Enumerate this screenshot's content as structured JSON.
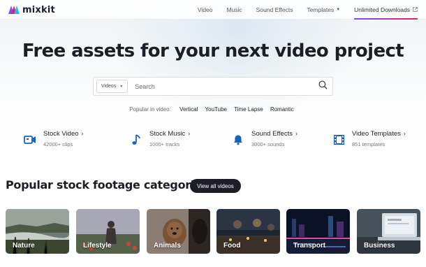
{
  "brand": {
    "name": "mixkit",
    "icon": "mixkit-logo"
  },
  "nav": [
    {
      "label": "Video"
    },
    {
      "label": "Music"
    },
    {
      "label": "Sound Effects"
    },
    {
      "label": "Templates",
      "has_dropdown": true
    },
    {
      "label": "Unlimited Downloads",
      "icon": "external-link-icon",
      "active": true
    }
  ],
  "hero": {
    "title": "Free assets for your next video project",
    "search": {
      "type_selected": "Videos",
      "placeholder": "Search",
      "value": "",
      "button_icon": "search-icon"
    },
    "popular_label": "Popular in video:",
    "popular_tags": [
      "Vertical",
      "YouTube",
      "Time Lapse",
      "Romantic"
    ]
  },
  "asset_types": [
    {
      "title": "Stock Video",
      "subtitle": "42000+ clips",
      "icon": "video-camera-icon"
    },
    {
      "title": "Stock Music",
      "subtitle": "1000+ tracks",
      "icon": "music-note-icon"
    },
    {
      "title": "Sound Effects",
      "subtitle": "3000+ sounds",
      "icon": "bell-icon"
    },
    {
      "title": "Video Templates",
      "subtitle": "851 templates",
      "icon": "film-strip-icon"
    }
  ],
  "categories": {
    "title": "Popular stock footage categories",
    "view_all_label": "View all videos",
    "items": [
      {
        "label": "Nature"
      },
      {
        "label": "Lifestyle"
      },
      {
        "label": "Animals"
      },
      {
        "label": "Food"
      },
      {
        "label": "Transport"
      },
      {
        "label": "Business"
      }
    ]
  },
  "colors": {
    "accent_icon": "#1565c0",
    "dark": "#1d1d27",
    "active_underline_start": "#7c4dff",
    "active_underline_end": "#e91e63"
  },
  "arrow_glyph": "›"
}
